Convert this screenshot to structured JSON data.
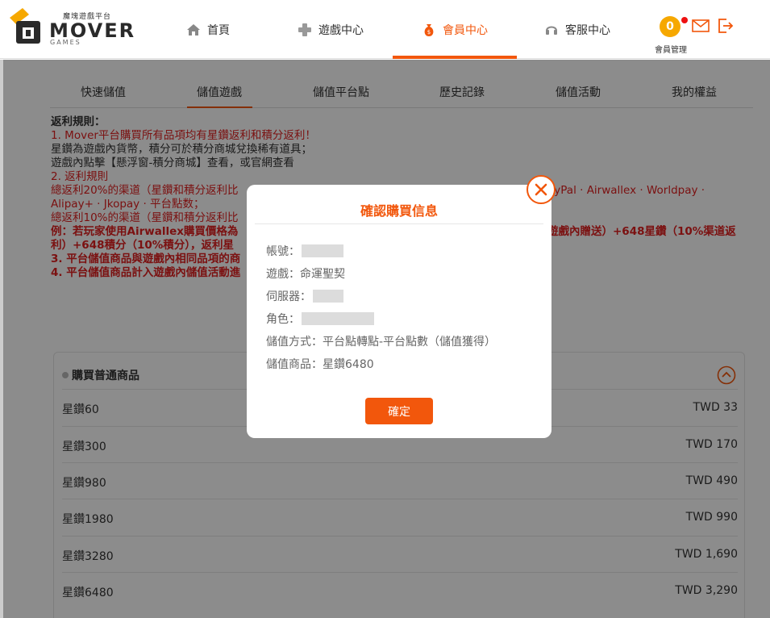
{
  "header": {
    "logo_tagline": "魔塊遊戲平台",
    "logo_word": "MOVER",
    "logo_sub": "GAMES",
    "nav": [
      {
        "label": "首頁",
        "icon": "home-icon"
      },
      {
        "label": "遊戲中心",
        "icon": "gamepad-icon"
      },
      {
        "label": "會員中心",
        "icon": "moneybag-icon"
      },
      {
        "label": "客服中心",
        "icon": "headset-icon"
      }
    ],
    "member_coin": "0",
    "member_label": "會員管理"
  },
  "subtabs": [
    "快速儲值",
    "儲值遊戲",
    "儲值平台點",
    "歷史記錄",
    "儲值活動",
    "我的權益"
  ],
  "rules": {
    "title": "返利規則：",
    "line1": "1. Mover平台購買所有品項均有星鑽返利和積分返利！",
    "line2": "星鑽為遊戲內貨幣，積分可於積分商城兌換稀有道具；",
    "line3": "遊戲內點擊【懸浮窗-積分商城】查看，或官網查看",
    "line4": "2. 返利規則",
    "line5a": "總返利20%的渠道（星鑽和積分返利比",
    "line5b": "ayPal · Airwallex · Worldpay ·",
    "line6": "Alipay+ · Jkopay · 平台點数；",
    "line7": "總返利10%的渠道（星鑽和積分返利比",
    "line8a": "例：若玩家使用Airwallex購買價格為",
    "line8b": "遊戲內贈送）+648星鑽（10%渠道返",
    "line9": "利）+648積分（10%積分），返利星",
    "line10": "3. 平台儲值商品與遊戲內相同品項的商",
    "line11": "4. 平台儲值商品計入遊戲內儲值活動進"
  },
  "panel": {
    "title": "購買普通商品",
    "products": [
      {
        "name": "星鑽60",
        "price": "TWD 33"
      },
      {
        "name": "星鑽300",
        "price": "TWD 170"
      },
      {
        "name": "星鑽980",
        "price": "TWD 490"
      },
      {
        "name": "星鑽1980",
        "price": "TWD 990"
      },
      {
        "name": "星鑽3280",
        "price": "TWD 1,690"
      },
      {
        "name": "星鑽6480",
        "price": "TWD 3,290"
      }
    ]
  },
  "modal": {
    "title": "確認購買信息",
    "account_label": "帳號：",
    "game_label": "遊戲：",
    "game_value": "命運聖契",
    "server_label": "伺服器：",
    "role_label": "角色：",
    "method_label": "儲值方式：",
    "method_value": "平台點轉點-平台點數（儲值獲得）",
    "product_label": "儲值商品：",
    "product_value": "星鑽6480",
    "confirm_label": "確定"
  },
  "colors": {
    "accent": "#f2570c",
    "rule_red": "#e02020",
    "coin": "#f6a800"
  }
}
